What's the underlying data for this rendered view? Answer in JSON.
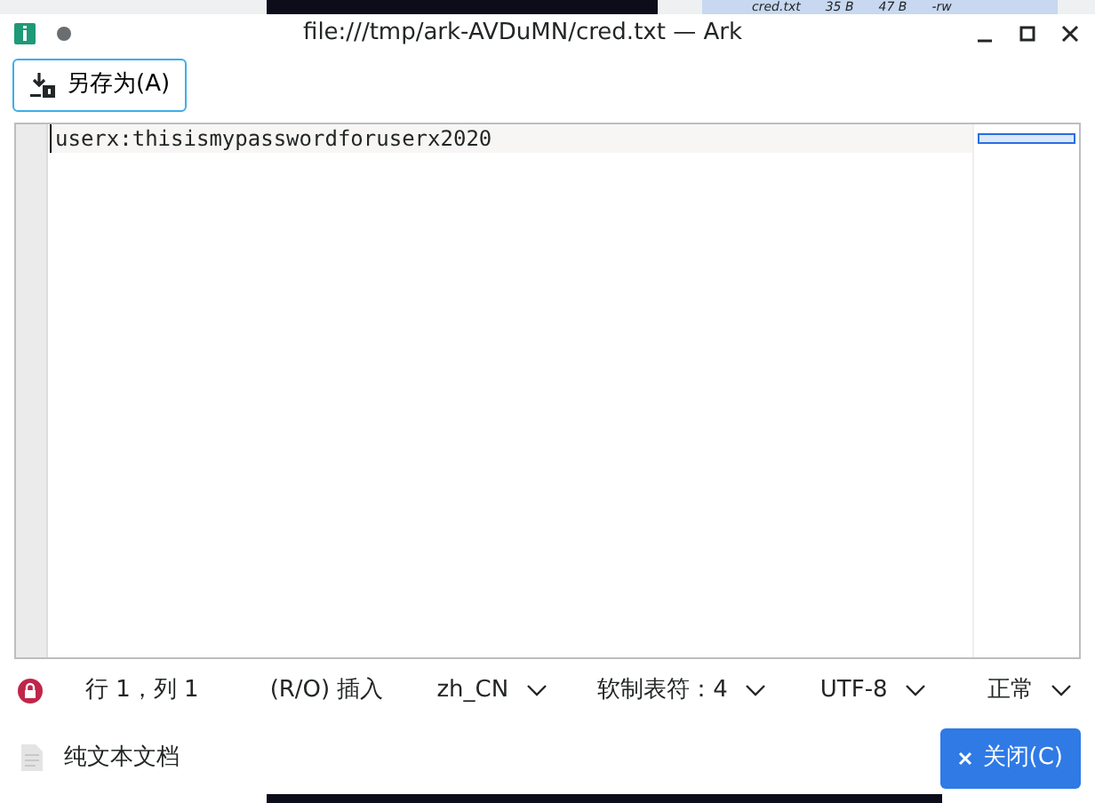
{
  "background": {
    "file_row": [
      "cred.txt",
      "35 B",
      "47 B",
      "-rw"
    ]
  },
  "window": {
    "title": "file:///tmp/ark-AVDuMN/cred.txt — Ark"
  },
  "toolbar": {
    "save_as": "另存为(A)"
  },
  "editor": {
    "lines": [
      "userx:thisismypasswordforuserx2020"
    ]
  },
  "status_bar": {
    "position": "行 1，列 1",
    "mode": "(R/O) 插入",
    "dropdowns": [
      {
        "label": "zh_CN"
      },
      {
        "label": "软制表符：4"
      },
      {
        "label": "UTF-8"
      },
      {
        "label": "正常"
      }
    ]
  },
  "footer": {
    "file_type": "纯文本文档",
    "close": "关闭(C)"
  }
}
